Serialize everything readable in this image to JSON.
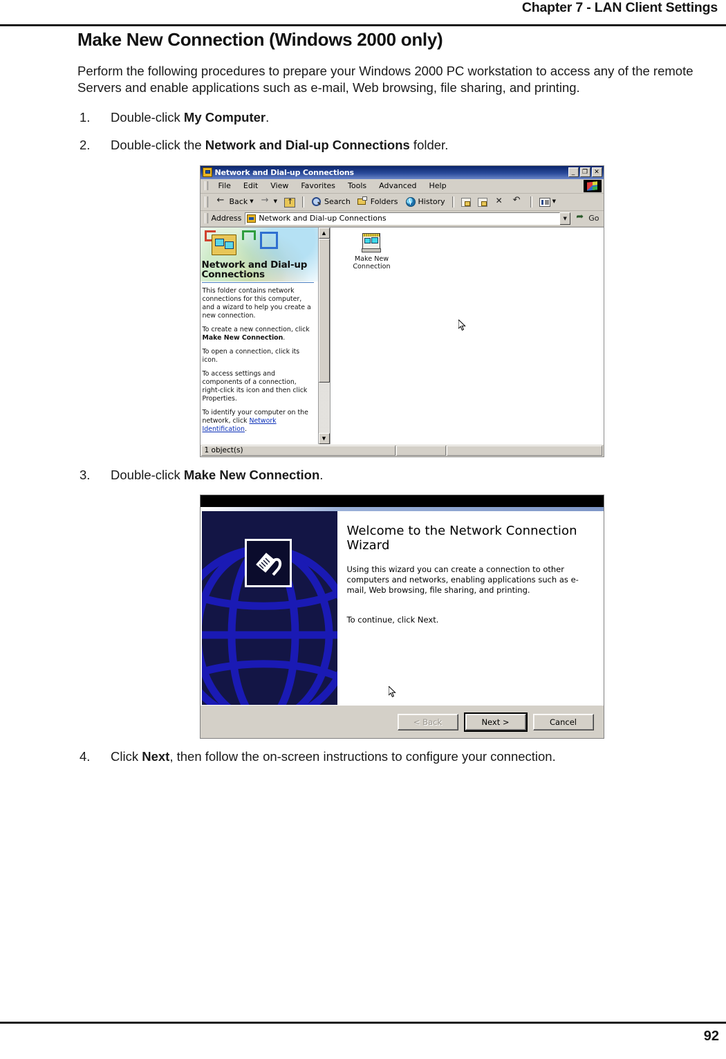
{
  "page": {
    "running_head": "Chapter 7 - LAN Client Settings",
    "folio": "92",
    "section_title": "Make New Connection (Windows 2000 only)",
    "intro": "Perform the following procedures to prepare your Windows 2000 PC workstation to access any of the remote Servers and enable applications such as e-mail, Web browsing, file sharing, and printing.",
    "steps": [
      {
        "num": "1.",
        "pre": "Double-click ",
        "bold": "My Computer",
        "post": "."
      },
      {
        "num": "2.",
        "pre": "Double-click the  ",
        "bold": "Network and Dial-up Connections",
        "post": " folder."
      },
      {
        "num": "3.",
        "pre": "Double-click ",
        "bold": "Make New Connection",
        "post": "."
      },
      {
        "num": "4.",
        "pre": "Click ",
        "bold": "Next",
        "post": ", then follow the on-screen instructions to configure your connection."
      }
    ]
  },
  "explorer": {
    "title": "Network and Dial-up Connections",
    "title_icon": "network-connections-icon",
    "window_buttons": {
      "minimize": "_",
      "restore": "❐",
      "close": "✕"
    },
    "menu": [
      "File",
      "Edit",
      "View",
      "Favorites",
      "Tools",
      "Advanced",
      "Help"
    ],
    "toolbar": {
      "back": "Back",
      "forward": "",
      "up": "",
      "search": "Search",
      "folders": "Folders",
      "history": "History",
      "move_to": "",
      "copy_to": "",
      "delete": "",
      "undo": "",
      "views": ""
    },
    "address": {
      "label": "Address",
      "value": "Network and Dial-up Connections",
      "go_label": "Go"
    },
    "left_pane": {
      "heading": "Network and Dial-up Connections",
      "paragraphs": [
        {
          "text": "This folder contains network connections for this computer, and a wizard to help you create a new connection."
        },
        {
          "pre": "To create a new connection, click ",
          "bold": "Make New Connection",
          "post": "."
        },
        {
          "text": "To open a connection, click its icon."
        },
        {
          "text": "To access settings and components of a connection, right-click its icon and then click Properties."
        },
        {
          "pre": "To identify your computer on the network, click ",
          "link": "Network Identification",
          "post": "."
        }
      ]
    },
    "items": [
      {
        "label_line1": "Make New",
        "label_line2": "Connection",
        "icon": "make-new-connection-icon"
      }
    ],
    "status": {
      "objects": "1 object(s)",
      "cell2": "",
      "cell3": ""
    }
  },
  "wizard": {
    "heading": "Welcome to the Network Connection Wizard",
    "paragraphs": [
      "Using this wizard you can create a connection to other computers and networks, enabling applications such as e-mail, Web browsing, file sharing, and printing.",
      "To continue, click Next."
    ],
    "buttons": {
      "back": "< Back",
      "next": "Next >",
      "cancel": "Cancel"
    },
    "graphic": {
      "globe": "globe-wireframe",
      "icon": "network-plug-icon"
    }
  },
  "colors": {
    "title_bar_start": "#0a246a",
    "title_bar_end": "#6a86c8",
    "face": "#d4d0c8",
    "wizard_panel": "#131545",
    "globe": "#1a1ab0",
    "link": "#0a2fb8"
  }
}
